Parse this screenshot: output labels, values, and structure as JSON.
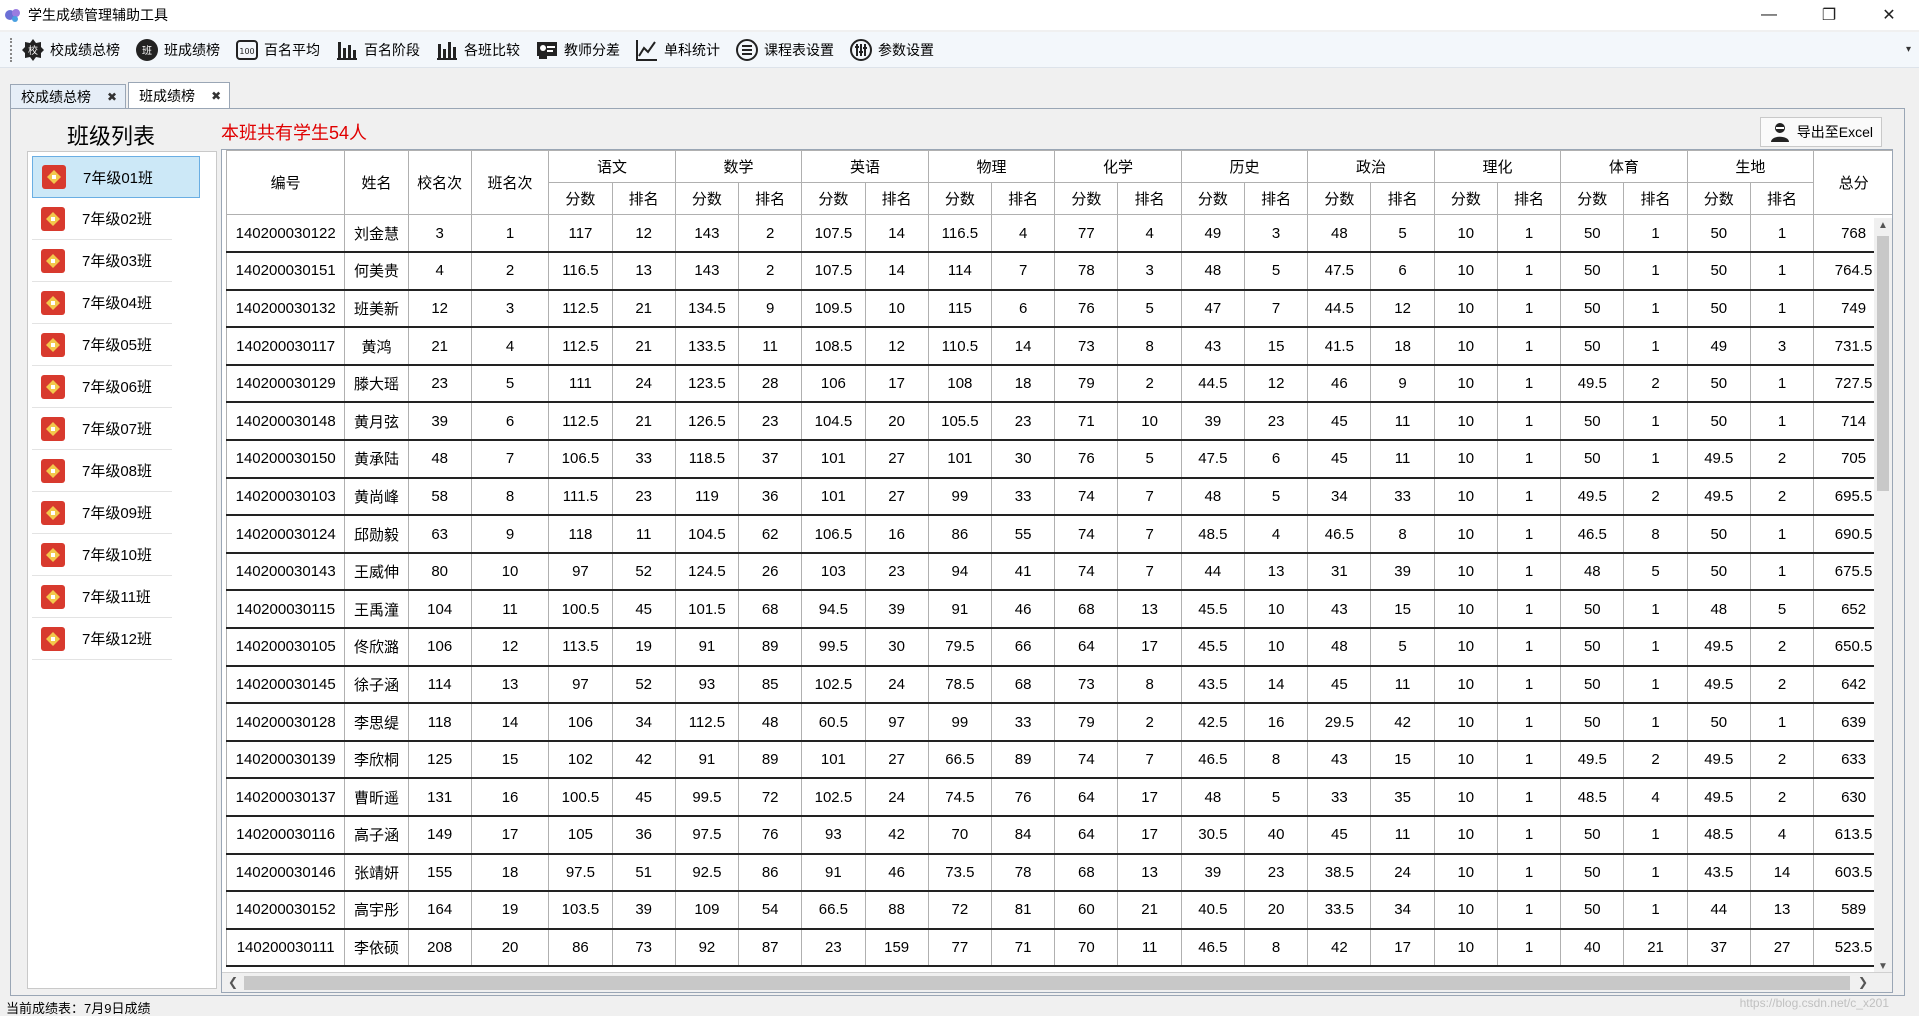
{
  "window": {
    "title": "学生成绩管理辅助工具",
    "controls": [
      "—",
      "❐",
      "✕"
    ]
  },
  "toolbar": {
    "items": [
      {
        "label": "校成绩总榜",
        "icon": "school-badge-icon"
      },
      {
        "label": "班成绩榜",
        "icon": "class-badge-icon"
      },
      {
        "label": "百名平均",
        "icon": "hundred-icon"
      },
      {
        "label": "百名阶段",
        "icon": "bar-chart-icon"
      },
      {
        "label": "各班比较",
        "icon": "bar-chart-compare-icon"
      },
      {
        "label": "教师分差",
        "icon": "teacher-icon"
      },
      {
        "label": "单科统计",
        "icon": "line-chart-icon"
      },
      {
        "label": "课程表设置",
        "icon": "list-circle-icon"
      },
      {
        "label": "参数设置",
        "icon": "sliders-icon"
      }
    ]
  },
  "tabs": [
    {
      "label": "校成绩总榜",
      "active": false
    },
    {
      "label": "班成绩榜",
      "active": true
    }
  ],
  "panel": {
    "list_title": "班级列表",
    "student_count": "本班共有学生54人",
    "export_label": "导出至Excel"
  },
  "classes": [
    {
      "label": "7年级01班",
      "selected": true
    },
    {
      "label": "7年级02班"
    },
    {
      "label": "7年级03班"
    },
    {
      "label": "7年级04班"
    },
    {
      "label": "7年级05班"
    },
    {
      "label": "7年级06班"
    },
    {
      "label": "7年级07班"
    },
    {
      "label": "7年级08班"
    },
    {
      "label": "7年级09班"
    },
    {
      "label": "7年级10班"
    },
    {
      "label": "7年级11班"
    },
    {
      "label": "7年级12班"
    }
  ],
  "grid": {
    "fixed_headers": [
      "编号",
      "姓名",
      "校名次",
      "班名次"
    ],
    "subjects": [
      "语文",
      "数学",
      "英语",
      "物理",
      "化学",
      "历史",
      "政治",
      "理化",
      "体育",
      "生地"
    ],
    "sub_headers": [
      "分数",
      "排名"
    ],
    "total_header": "总分",
    "rows": [
      [
        "140200030122",
        "刘金慧",
        "3",
        "1",
        "117",
        "12",
        "143",
        "2",
        "107.5",
        "14",
        "116.5",
        "4",
        "77",
        "4",
        "49",
        "3",
        "48",
        "5",
        "10",
        "1",
        "50",
        "1",
        "50",
        "1",
        "768"
      ],
      [
        "140200030151",
        "何美贵",
        "4",
        "2",
        "116.5",
        "13",
        "143",
        "2",
        "107.5",
        "14",
        "114",
        "7",
        "78",
        "3",
        "48",
        "5",
        "47.5",
        "6",
        "10",
        "1",
        "50",
        "1",
        "50",
        "1",
        "764.5"
      ],
      [
        "140200030132",
        "班美新",
        "12",
        "3",
        "112.5",
        "21",
        "134.5",
        "9",
        "109.5",
        "10",
        "115",
        "6",
        "76",
        "5",
        "47",
        "7",
        "44.5",
        "12",
        "10",
        "1",
        "50",
        "1",
        "50",
        "1",
        "749"
      ],
      [
        "140200030117",
        "黄鸿",
        "21",
        "4",
        "112.5",
        "21",
        "133.5",
        "11",
        "108.5",
        "12",
        "110.5",
        "14",
        "73",
        "8",
        "43",
        "15",
        "41.5",
        "18",
        "10",
        "1",
        "50",
        "1",
        "49",
        "3",
        "731.5"
      ],
      [
        "140200030129",
        "滕大瑶",
        "23",
        "5",
        "111",
        "24",
        "123.5",
        "28",
        "106",
        "17",
        "108",
        "18",
        "79",
        "2",
        "44.5",
        "12",
        "46",
        "9",
        "10",
        "1",
        "49.5",
        "2",
        "50",
        "1",
        "727.5"
      ],
      [
        "140200030148",
        "黄月弦",
        "39",
        "6",
        "112.5",
        "21",
        "126.5",
        "23",
        "104.5",
        "20",
        "105.5",
        "23",
        "71",
        "10",
        "39",
        "23",
        "45",
        "11",
        "10",
        "1",
        "50",
        "1",
        "50",
        "1",
        "714"
      ],
      [
        "140200030150",
        "黄承陆",
        "48",
        "7",
        "106.5",
        "33",
        "118.5",
        "37",
        "101",
        "27",
        "101",
        "30",
        "76",
        "5",
        "47.5",
        "6",
        "45",
        "11",
        "10",
        "1",
        "50",
        "1",
        "49.5",
        "2",
        "705"
      ],
      [
        "140200030103",
        "黄尚峰",
        "58",
        "8",
        "111.5",
        "23",
        "119",
        "36",
        "101",
        "27",
        "99",
        "33",
        "74",
        "7",
        "48",
        "5",
        "34",
        "33",
        "10",
        "1",
        "49.5",
        "2",
        "49.5",
        "2",
        "695.5"
      ],
      [
        "140200030124",
        "邱勋毅",
        "63",
        "9",
        "118",
        "11",
        "104.5",
        "62",
        "106.5",
        "16",
        "86",
        "55",
        "74",
        "7",
        "48.5",
        "4",
        "46.5",
        "8",
        "10",
        "1",
        "46.5",
        "8",
        "50",
        "1",
        "690.5"
      ],
      [
        "140200030143",
        "王威伸",
        "80",
        "10",
        "97",
        "52",
        "124.5",
        "26",
        "103",
        "23",
        "94",
        "41",
        "74",
        "7",
        "44",
        "13",
        "31",
        "39",
        "10",
        "1",
        "48",
        "5",
        "50",
        "1",
        "675.5"
      ],
      [
        "140200030115",
        "王禹潼",
        "104",
        "11",
        "100.5",
        "45",
        "101.5",
        "68",
        "94.5",
        "39",
        "91",
        "46",
        "68",
        "13",
        "45.5",
        "10",
        "43",
        "15",
        "10",
        "1",
        "50",
        "1",
        "48",
        "5",
        "652"
      ],
      [
        "140200030105",
        "佟欣潞",
        "106",
        "12",
        "113.5",
        "19",
        "91",
        "89",
        "99.5",
        "30",
        "79.5",
        "66",
        "64",
        "17",
        "45.5",
        "10",
        "48",
        "5",
        "10",
        "1",
        "50",
        "1",
        "49.5",
        "2",
        "650.5"
      ],
      [
        "140200030145",
        "徐子涵",
        "114",
        "13",
        "97",
        "52",
        "93",
        "85",
        "102.5",
        "24",
        "78.5",
        "68",
        "73",
        "8",
        "43.5",
        "14",
        "45",
        "11",
        "10",
        "1",
        "50",
        "1",
        "49.5",
        "2",
        "642"
      ],
      [
        "140200030128",
        "李思缇",
        "118",
        "14",
        "106",
        "34",
        "112.5",
        "48",
        "60.5",
        "97",
        "99",
        "33",
        "79",
        "2",
        "42.5",
        "16",
        "29.5",
        "42",
        "10",
        "1",
        "50",
        "1",
        "50",
        "1",
        "639"
      ],
      [
        "140200030139",
        "李欣桐",
        "125",
        "15",
        "102",
        "42",
        "91",
        "89",
        "101",
        "27",
        "66.5",
        "89",
        "74",
        "7",
        "46.5",
        "8",
        "43",
        "15",
        "10",
        "1",
        "49.5",
        "2",
        "49.5",
        "2",
        "633"
      ],
      [
        "140200030137",
        "曹昕遥",
        "131",
        "16",
        "100.5",
        "45",
        "99.5",
        "72",
        "102.5",
        "24",
        "74.5",
        "76",
        "64",
        "17",
        "48",
        "5",
        "33",
        "35",
        "10",
        "1",
        "48.5",
        "4",
        "49.5",
        "2",
        "630"
      ],
      [
        "140200030116",
        "高子涵",
        "149",
        "17",
        "105",
        "36",
        "97.5",
        "76",
        "93",
        "42",
        "70",
        "84",
        "64",
        "17",
        "30.5",
        "40",
        "45",
        "11",
        "10",
        "1",
        "50",
        "1",
        "48.5",
        "4",
        "613.5"
      ],
      [
        "140200030146",
        "张靖妍",
        "155",
        "18",
        "97.5",
        "51",
        "92.5",
        "86",
        "91",
        "46",
        "73.5",
        "78",
        "68",
        "13",
        "39",
        "23",
        "38.5",
        "24",
        "10",
        "1",
        "50",
        "1",
        "43.5",
        "14",
        "603.5"
      ],
      [
        "140200030152",
        "高宇彤",
        "164",
        "19",
        "103.5",
        "39",
        "109",
        "54",
        "66.5",
        "88",
        "72",
        "81",
        "60",
        "21",
        "40.5",
        "20",
        "33.5",
        "34",
        "10",
        "1",
        "50",
        "1",
        "44",
        "13",
        "589"
      ],
      [
        "140200030111",
        "李依硕",
        "208",
        "20",
        "86",
        "73",
        "92",
        "87",
        "23",
        "159",
        "77",
        "71",
        "70",
        "11",
        "46.5",
        "8",
        "42",
        "17",
        "10",
        "1",
        "40",
        "21",
        "37",
        "27",
        "523.5"
      ]
    ]
  },
  "status": {
    "text": "当前成绩表：7月9日成绩"
  },
  "watermark": "https://blog.csdn.net/c_x201"
}
